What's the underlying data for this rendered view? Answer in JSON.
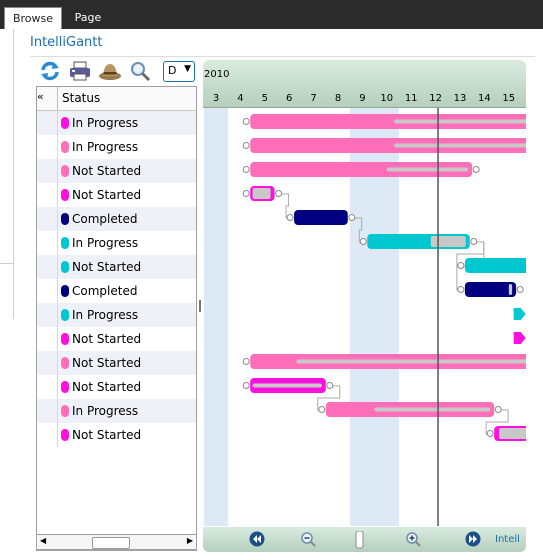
{
  "ribbon": {
    "tabs": [
      {
        "label": "Browse"
      },
      {
        "label": "Page"
      }
    ]
  },
  "app": {
    "title": "IntelliGantt"
  },
  "toolbar": {
    "zoom_value": "D"
  },
  "grid": {
    "header": {
      "column": "Status"
    },
    "rows": [
      {
        "status": "In Progress",
        "color": "#ff10e0"
      },
      {
        "status": "In Progress",
        "color": "#ff6eb8"
      },
      {
        "status": "Not Started",
        "color": "#ff6eb8"
      },
      {
        "status": "Not Started",
        "color": "#ff10e0"
      },
      {
        "status": "Completed",
        "color": "#000080"
      },
      {
        "status": "In Progress",
        "color": "#00c8d0"
      },
      {
        "status": "Not Started",
        "color": "#00c8d0"
      },
      {
        "status": "Completed",
        "color": "#000080"
      },
      {
        "status": "In Progress",
        "color": "#00c8d0"
      },
      {
        "status": "Not Started",
        "color": "#ff10e0"
      },
      {
        "status": "Not Started",
        "color": "#ff6eb8"
      },
      {
        "status": "Not Started",
        "color": "#ff10e0"
      },
      {
        "status": "In Progress",
        "color": "#ff6eb8"
      },
      {
        "status": "Not Started",
        "color": "#ff10e0"
      }
    ]
  },
  "timeline": {
    "year": "2010",
    "weeks": [
      "3",
      "4",
      "5",
      "6",
      "7",
      "8",
      "9",
      "10",
      "11",
      "12",
      "13",
      "14",
      "15"
    ],
    "today_week": 12.1,
    "shaded_ranges": [
      [
        3,
        4
      ],
      [
        9,
        11
      ]
    ]
  },
  "chart_data": {
    "type": "gantt",
    "x_unit": "week number (2010)",
    "tasks": [
      {
        "start": 4.4,
        "end": 16.5,
        "progress_start": 10.3,
        "color": "#ff6eb8",
        "kind": "bar"
      },
      {
        "start": 4.4,
        "end": 16.5,
        "progress_start": 10.3,
        "color": "#ff6eb8",
        "kind": "bar"
      },
      {
        "start": 4.4,
        "end": 13.5,
        "progress_start": 10.0,
        "color": "#ff6eb8",
        "kind": "bar"
      },
      {
        "start": 4.4,
        "end": 5.4,
        "progress_start": 4.5,
        "color": "#ff10e0",
        "kind": "bar"
      },
      {
        "start": 6.2,
        "end": 8.4,
        "progress_start": null,
        "color": "#000080",
        "kind": "bar"
      },
      {
        "start": 9.2,
        "end": 13.4,
        "progress_start": 11.8,
        "color": "#00c8d0",
        "kind": "bar"
      },
      {
        "start": 13.2,
        "end": 16.5,
        "progress_start": null,
        "color": "#00c8d0",
        "kind": "bar"
      },
      {
        "start": 13.2,
        "end": 15.3,
        "progress_start": 15.0,
        "color": "#000080",
        "kind": "bar"
      },
      {
        "start": 15.2,
        "end": 15.6,
        "progress_start": null,
        "color": "#00c8d0",
        "kind": "milestone"
      },
      {
        "start": 15.2,
        "end": 15.6,
        "progress_start": null,
        "color": "#ff10e0",
        "kind": "milestone"
      },
      {
        "start": 4.4,
        "end": 16.5,
        "progress_start": 6.3,
        "color": "#ff6eb8",
        "kind": "bar"
      },
      {
        "start": 4.4,
        "end": 7.5,
        "progress_start": 4.5,
        "color": "#ff10e0",
        "kind": "bar"
      },
      {
        "start": 7.5,
        "end": 14.4,
        "progress_start": 9.5,
        "color": "#ff6eb8",
        "kind": "bar"
      },
      {
        "start": 14.4,
        "end": 16.5,
        "progress_start": 14.6,
        "color": "#ff10e0",
        "kind": "bar"
      }
    ],
    "links": [
      [
        3,
        4
      ],
      [
        4,
        5
      ],
      [
        5,
        6
      ],
      [
        5,
        7
      ],
      [
        11,
        12
      ],
      [
        12,
        13
      ]
    ]
  },
  "footer": {
    "link_text": "Intell"
  }
}
